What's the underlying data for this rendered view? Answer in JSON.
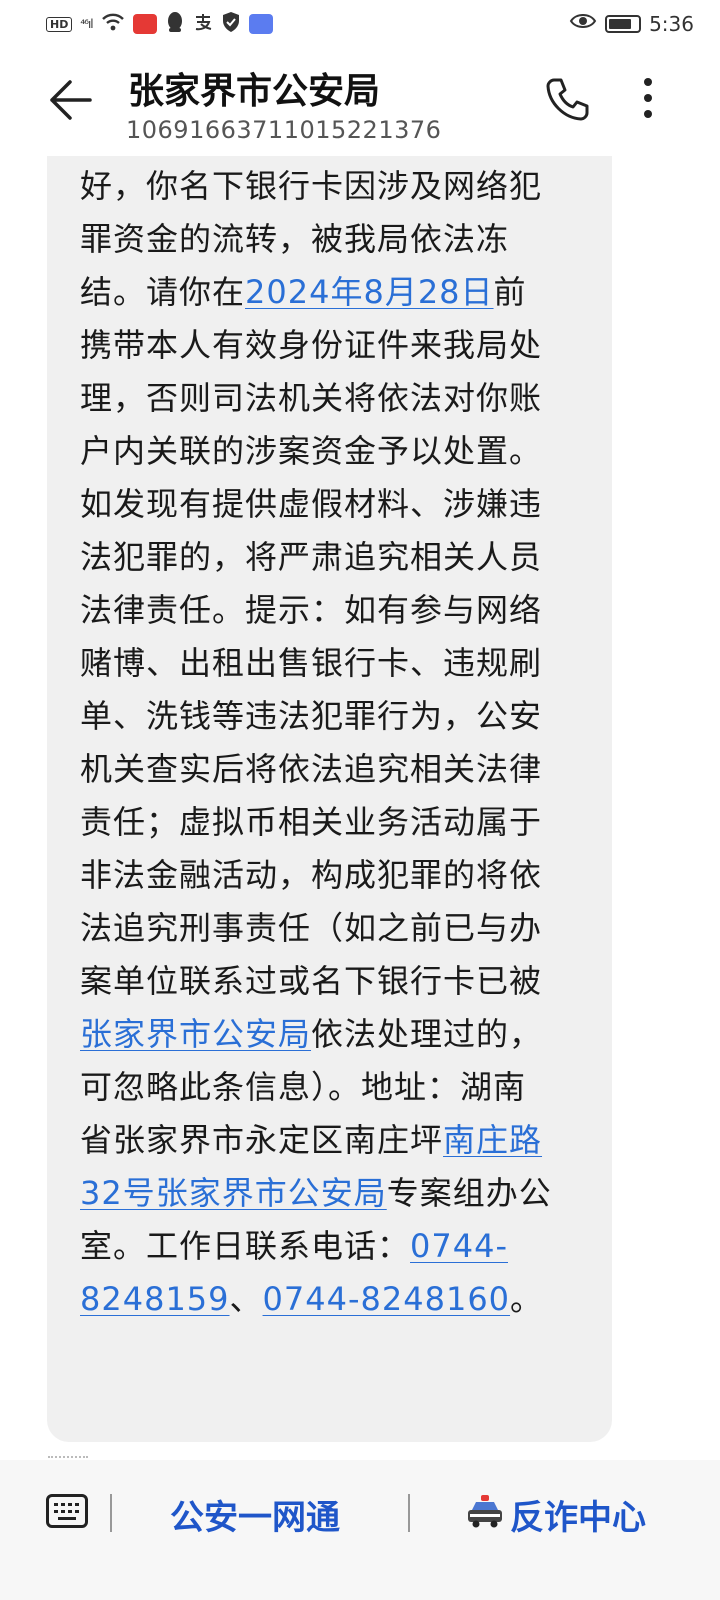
{
  "status_bar": {
    "hd": "HD",
    "signal": "⁴⁶ıl",
    "time": "5:36"
  },
  "header": {
    "title": "张家界市公安局",
    "number": "10691663711015221376"
  },
  "message": {
    "segments": [
      {
        "text": "好，你名下银行卡因涉及网络犯罪资金的流转，被我局依法冻结。请你在"
      },
      {
        "text": "2024年8月28日",
        "link": true
      },
      {
        "text": "前携带本人有效身份证件来我局处理，否则司法机关将依法对你账户内关联的涉案资金予以处置。如发现有提供虚假材料、涉嫌违法犯罪的，将严肃追究相关人员法律责任。提示：如有参与网络赌博、出租出售银行卡、违规刷单、洗钱等违法犯罪行为，公安机关查实后将依法追究相关法律责任；虚拟币相关业务活动属于非法金融活动，构成犯罪的将依法追究刑事责任（如之前已与办案单位联系过或名下银行卡已被"
      },
      {
        "text": "张家界市公安局",
        "link": true
      },
      {
        "text": "依法处理过的，可忽略此条信息）。地址：湖南省张家界市永定区南庄坪"
      },
      {
        "text": "南庄路32号张家界市公安局",
        "link": true
      },
      {
        "text": "专案组办公室。工作日联系电话："
      },
      {
        "text": "0744-8248159",
        "link": true
      },
      {
        "text": "、"
      },
      {
        "text": "0744-8248160",
        "link": true
      },
      {
        "text": "。"
      }
    ]
  },
  "bottom_menu": {
    "item1": "公安一网通",
    "item2": "反诈中心"
  },
  "icons": {
    "back": "back-arrow-icon",
    "call": "phone-icon",
    "more": "more-vertical-icon",
    "keyboard": "keyboard-icon",
    "police": "police-car-icon"
  },
  "colors": {
    "link": "#2a6fd6",
    "menu": "#1f56c9",
    "bubble": "#f0f0f0"
  }
}
